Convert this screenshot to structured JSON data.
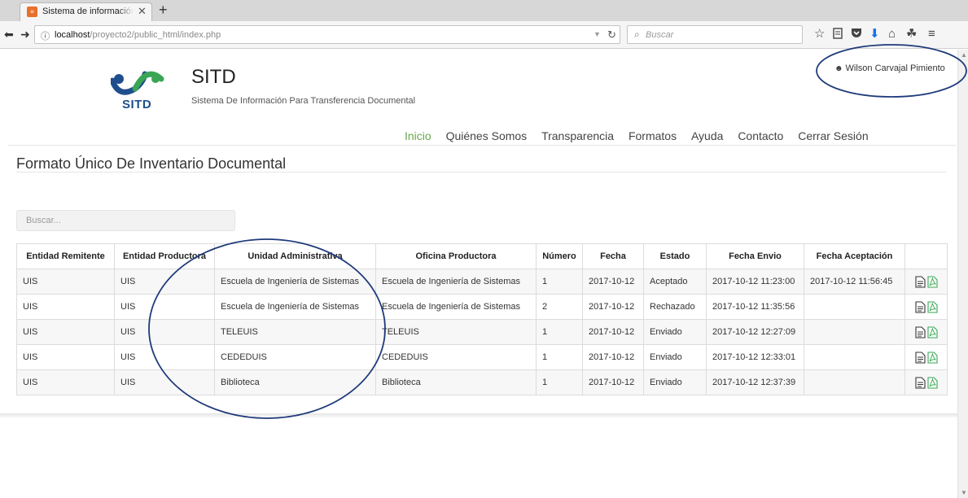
{
  "browser": {
    "tab_title": "Sistema de información par",
    "tab_close": "✕",
    "new_tab": "+",
    "url_host": "localhost",
    "url_path": "/proyecto2/public_html/index.php",
    "search_placeholder": "Buscar"
  },
  "header": {
    "logo_text": "SITD",
    "site_name": "SITD",
    "site_subtitle": "Sistema De Información Para Transferencia Documental",
    "user_name": "Wilson Carvajal Pimiento"
  },
  "menu": {
    "items": [
      {
        "label": "Inicio",
        "active": true
      },
      {
        "label": "Quiénes Somos"
      },
      {
        "label": "Transparencia"
      },
      {
        "label": "Formatos"
      },
      {
        "label": "Ayuda"
      },
      {
        "label": "Contacto"
      },
      {
        "label": "Cerrar Sesión"
      }
    ]
  },
  "content": {
    "title": "Formato Único De Inventario Documental",
    "search_placeholder": "Buscar..."
  },
  "table": {
    "headers": [
      "Entidad Remitente",
      "Entidad Productora",
      "Unidad Administrativa",
      "Oficina Productora",
      "Número",
      "Fecha",
      "Estado",
      "Fecha Envio",
      "Fecha Aceptación",
      ""
    ],
    "rows": [
      [
        "UIS",
        "UIS",
        "Escuela de Ingeniería de Sistemas",
        "Escuela de Ingeniería de Sistemas",
        "1",
        "2017-10-12",
        "Aceptado",
        "2017-10-12 11:23:00",
        "2017-10-12 11:56:45"
      ],
      [
        "UIS",
        "UIS",
        "Escuela de Ingeniería de Sistemas",
        "Escuela de Ingeniería de Sistemas",
        "2",
        "2017-10-12",
        "Rechazado",
        "2017-10-12 11:35:56",
        ""
      ],
      [
        "UIS",
        "UIS",
        "TELEUIS",
        "TELEUIS",
        "1",
        "2017-10-12",
        "Enviado",
        "2017-10-12 12:27:09",
        ""
      ],
      [
        "UIS",
        "UIS",
        "CEDEDUIS",
        "CEDEDUIS",
        "1",
        "2017-10-12",
        "Enviado",
        "2017-10-12 12:33:01",
        ""
      ],
      [
        "UIS",
        "UIS",
        "Biblioteca",
        "Biblioteca",
        "1",
        "2017-10-12",
        "Enviado",
        "2017-10-12 12:37:39",
        ""
      ]
    ]
  },
  "colors": {
    "accent_green": "#6aa84f",
    "logo_blue": "#1e4e8c",
    "annotation_navy": "#1f3a7a",
    "pdf_green": "#3aa655"
  }
}
